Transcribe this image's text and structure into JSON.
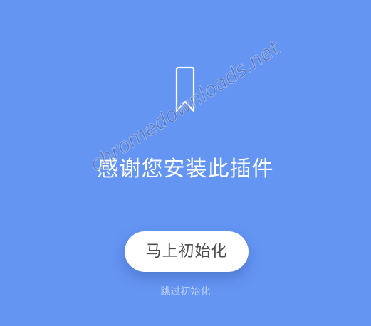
{
  "colors": {
    "background": "#6495f3",
    "button_bg": "#ffffff",
    "button_text": "#4d4d4d",
    "title_text": "#ffffff"
  },
  "icon": {
    "name": "bookmark-icon"
  },
  "main": {
    "title": "感谢您安装此插件",
    "init_button_label": "马上初始化",
    "skip_link_label": "跳过初始化"
  },
  "watermark": {
    "text": "chromedownloads.net"
  }
}
